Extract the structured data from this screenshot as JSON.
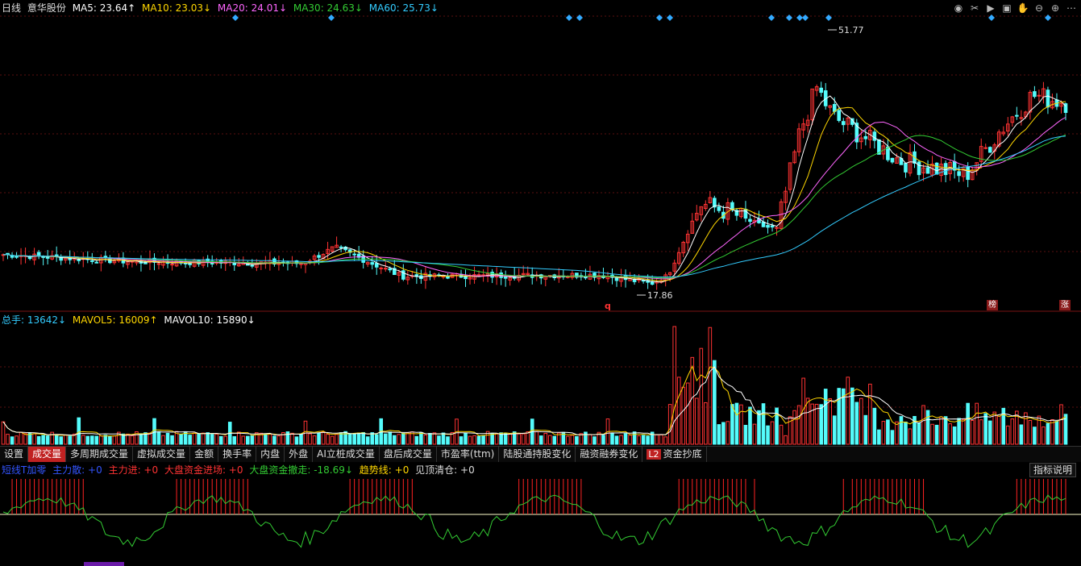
{
  "header": {
    "period": "日线",
    "stock_name": "意华股份",
    "ma": [
      {
        "label": "MA5: 23.64↑",
        "color": "#ffffff"
      },
      {
        "label": "MA10: 23.03↓",
        "color": "#ffd700"
      },
      {
        "label": "MA20: 24.01↓",
        "color": "#ff66ff"
      },
      {
        "label": "MA30: 24.63↓",
        "color": "#33cc33"
      },
      {
        "label": "MA60: 25.73↓",
        "color": "#33ccff"
      }
    ]
  },
  "price_annotations": {
    "high_label": "51.77",
    "low_label": "17.86",
    "q_marker": "q",
    "badge_bang": "榜",
    "badge_zhang": "涨"
  },
  "volume_header": {
    "items": [
      {
        "label": "总手: 13642↓",
        "color": "#33ccff"
      },
      {
        "label": "MAVOL5: 16009↑",
        "color": "#ffd700"
      },
      {
        "label": "MAVOL10: 15890↓",
        "color": "#ffffff"
      }
    ]
  },
  "tabs": [
    {
      "label": "设置"
    },
    {
      "label": "成交量",
      "active": true
    },
    {
      "label": "多周期成交量"
    },
    {
      "label": "虚拟成交量"
    },
    {
      "label": "金额"
    },
    {
      "label": "换手率"
    },
    {
      "label": "内盘"
    },
    {
      "label": "外盘"
    },
    {
      "label": "AI立桩成交量"
    },
    {
      "label": "盘后成交量"
    },
    {
      "label": "市盈率(ttm)"
    },
    {
      "label": "陆股通持股变化"
    },
    {
      "label": "融资融券变化"
    },
    {
      "label": "资金抄底",
      "l2": "L2"
    }
  ],
  "indicator_header": {
    "items": [
      {
        "label": "短线T加零",
        "color": "#3355ff"
      },
      {
        "label": "主力散: +0",
        "color": "#3355ff"
      },
      {
        "label": "主力进: +0",
        "color": "#ff3333"
      },
      {
        "label": "大盘资金进场: +0",
        "color": "#ff3333"
      },
      {
        "label": "大盘资金撤走: -18.69↓",
        "color": "#33cc33"
      },
      {
        "label": "趋势线: +0",
        "color": "#ffd700"
      },
      {
        "label": "见顶清仓: +0",
        "color": "#dddddd"
      }
    ],
    "explain_button": "指标说明"
  },
  "toolbar_icons": [
    "eye-icon",
    "scissors-icon",
    "play-icon",
    "lock-icon",
    "hand-icon",
    "zoom-out-icon",
    "zoom-in-icon",
    "more-icon"
  ],
  "chart_data": {
    "type": "candlestick",
    "price_high": 51.77,
    "price_low": 17.86,
    "volume_scale_note": "",
    "colors": {
      "up": "#ff3333",
      "down": "#54fcfc"
    }
  }
}
